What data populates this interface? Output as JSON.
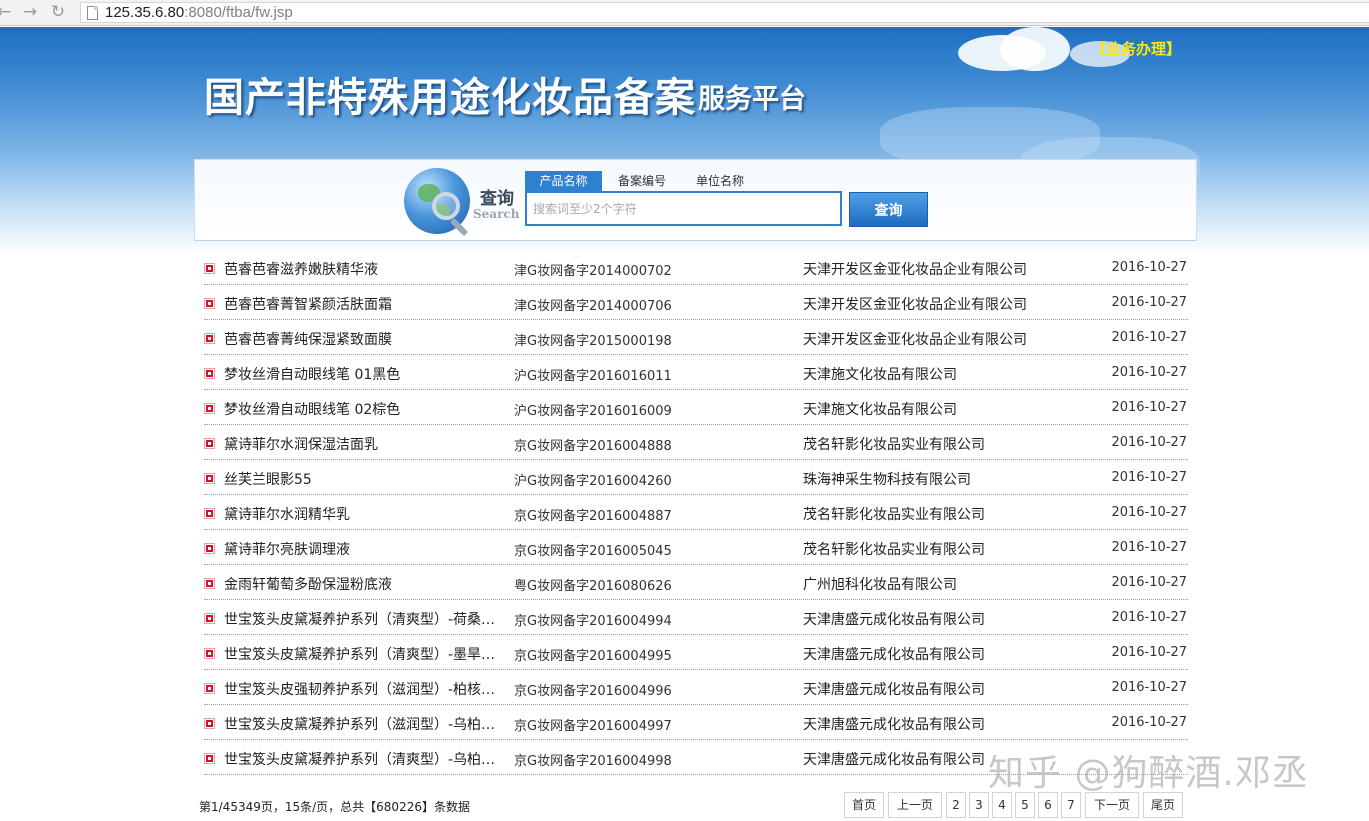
{
  "browser": {
    "url_host": "125.35.6.80",
    "url_rest": ":8080/ftba/fw.jsp"
  },
  "header": {
    "title": "国产非特殊用途化妆品备案",
    "subtitle": "服务平台",
    "business_link": "【业务办理】"
  },
  "search": {
    "title": "查询",
    "title_en": "Search",
    "tabs": [
      {
        "label": "产品名称",
        "active": true
      },
      {
        "label": "备案编号",
        "active": false
      },
      {
        "label": "单位名称",
        "active": false
      }
    ],
    "placeholder": "搜索词至少2个字符",
    "button_label": "查询"
  },
  "results": [
    {
      "name": "芭睿芭睿滋养嫩肤精华液",
      "code": "津G妆网备字2014000702",
      "company": "天津开发区金亚化妆品企业有限公司",
      "date": "2016-10-27"
    },
    {
      "name": "芭睿芭睿菁智紧颜活肤面霜",
      "code": "津G妆网备字2014000706",
      "company": "天津开发区金亚化妆品企业有限公司",
      "date": "2016-10-27"
    },
    {
      "name": "芭睿芭睿菁纯保湿紧致面膜",
      "code": "津G妆网备字2015000198",
      "company": "天津开发区金亚化妆品企业有限公司",
      "date": "2016-10-27"
    },
    {
      "name": "梦妆丝滑自动眼线笔 01黑色",
      "code": "沪G妆网备字2016016011",
      "company": "天津施文化妆品有限公司",
      "date": "2016-10-27"
    },
    {
      "name": "梦妆丝滑自动眼线笔 02棕色",
      "code": "沪G妆网备字2016016009",
      "company": "天津施文化妆品有限公司",
      "date": "2016-10-27"
    },
    {
      "name": "黛诗菲尔水润保湿洁面乳",
      "code": "京G妆网备字2016004888",
      "company": "茂名轩影化妆品实业有限公司",
      "date": "2016-10-27"
    },
    {
      "name": "丝芙兰眼影55",
      "code": "沪G妆网备字2016004260",
      "company": "珠海神采生物科技有限公司",
      "date": "2016-10-27"
    },
    {
      "name": "黛诗菲尔水润精华乳",
      "code": "京G妆网备字2016004887",
      "company": "茂名轩影化妆品实业有限公司",
      "date": "2016-10-27"
    },
    {
      "name": "黛诗菲尔亮肤调理液",
      "code": "京G妆网备字2016005045",
      "company": "茂名轩影化妆品实业有限公司",
      "date": "2016-10-27"
    },
    {
      "name": "金雨轩葡萄多酚保湿粉底液",
      "code": "粤G妆网备字2016080626",
      "company": "广州旭科化妆品有限公司",
      "date": "2016-10-27"
    },
    {
      "name": "世宝笈头皮黛凝养护系列（清爽型）-荷桑…",
      "code": "京G妆网备字2016004994",
      "company": "天津唐盛元成化妆品有限公司",
      "date": "2016-10-27"
    },
    {
      "name": "世宝笈头皮黛凝养护系列（清爽型）-墨旱…",
      "code": "京G妆网备字2016004995",
      "company": "天津唐盛元成化妆品有限公司",
      "date": "2016-10-27"
    },
    {
      "name": "世宝笈头皮强韧养护系列（滋润型）-柏核…",
      "code": "京G妆网备字2016004996",
      "company": "天津唐盛元成化妆品有限公司",
      "date": "2016-10-27"
    },
    {
      "name": "世宝笈头皮黛凝养护系列（滋润型）-乌柏…",
      "code": "京G妆网备字2016004997",
      "company": "天津唐盛元成化妆品有限公司",
      "date": "2016-10-27"
    },
    {
      "name": "世宝笈头皮黛凝养护系列（清爽型）-乌柏…",
      "code": "京G妆网备字2016004998",
      "company": "天津唐盛元成化妆品有限公司",
      "date": ""
    }
  ],
  "footer": {
    "info": "第1/45349页，15条/页，总共【680226】条数据",
    "pages": [
      {
        "label": "首页"
      },
      {
        "label": "上一页"
      },
      {
        "label": "2"
      },
      {
        "label": "3"
      },
      {
        "label": "4"
      },
      {
        "label": "5"
      },
      {
        "label": "6"
      },
      {
        "label": "7"
      },
      {
        "label": "下一页"
      },
      {
        "label": "尾页"
      }
    ]
  },
  "watermark": "知乎 @狗醉酒.邓丞"
}
